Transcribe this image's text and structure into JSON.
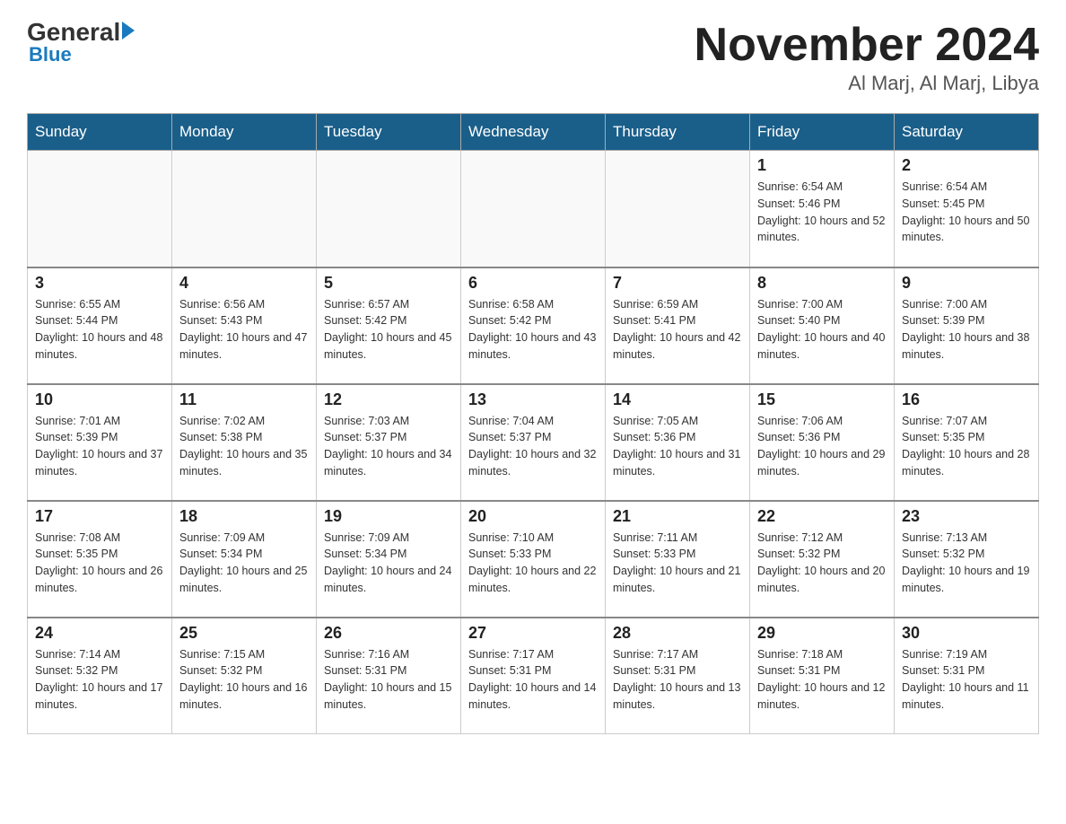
{
  "header": {
    "logo_general": "General",
    "logo_blue": "Blue",
    "month_title": "November 2024",
    "location": "Al Marj, Al Marj, Libya"
  },
  "days_of_week": [
    "Sunday",
    "Monday",
    "Tuesday",
    "Wednesday",
    "Thursday",
    "Friday",
    "Saturday"
  ],
  "weeks": [
    [
      {
        "day": "",
        "sunrise": "",
        "sunset": "",
        "daylight": ""
      },
      {
        "day": "",
        "sunrise": "",
        "sunset": "",
        "daylight": ""
      },
      {
        "day": "",
        "sunrise": "",
        "sunset": "",
        "daylight": ""
      },
      {
        "day": "",
        "sunrise": "",
        "sunset": "",
        "daylight": ""
      },
      {
        "day": "",
        "sunrise": "",
        "sunset": "",
        "daylight": ""
      },
      {
        "day": "1",
        "sunrise": "Sunrise: 6:54 AM",
        "sunset": "Sunset: 5:46 PM",
        "daylight": "Daylight: 10 hours and 52 minutes."
      },
      {
        "day": "2",
        "sunrise": "Sunrise: 6:54 AM",
        "sunset": "Sunset: 5:45 PM",
        "daylight": "Daylight: 10 hours and 50 minutes."
      }
    ],
    [
      {
        "day": "3",
        "sunrise": "Sunrise: 6:55 AM",
        "sunset": "Sunset: 5:44 PM",
        "daylight": "Daylight: 10 hours and 48 minutes."
      },
      {
        "day": "4",
        "sunrise": "Sunrise: 6:56 AM",
        "sunset": "Sunset: 5:43 PM",
        "daylight": "Daylight: 10 hours and 47 minutes."
      },
      {
        "day": "5",
        "sunrise": "Sunrise: 6:57 AM",
        "sunset": "Sunset: 5:42 PM",
        "daylight": "Daylight: 10 hours and 45 minutes."
      },
      {
        "day": "6",
        "sunrise": "Sunrise: 6:58 AM",
        "sunset": "Sunset: 5:42 PM",
        "daylight": "Daylight: 10 hours and 43 minutes."
      },
      {
        "day": "7",
        "sunrise": "Sunrise: 6:59 AM",
        "sunset": "Sunset: 5:41 PM",
        "daylight": "Daylight: 10 hours and 42 minutes."
      },
      {
        "day": "8",
        "sunrise": "Sunrise: 7:00 AM",
        "sunset": "Sunset: 5:40 PM",
        "daylight": "Daylight: 10 hours and 40 minutes."
      },
      {
        "day": "9",
        "sunrise": "Sunrise: 7:00 AM",
        "sunset": "Sunset: 5:39 PM",
        "daylight": "Daylight: 10 hours and 38 minutes."
      }
    ],
    [
      {
        "day": "10",
        "sunrise": "Sunrise: 7:01 AM",
        "sunset": "Sunset: 5:39 PM",
        "daylight": "Daylight: 10 hours and 37 minutes."
      },
      {
        "day": "11",
        "sunrise": "Sunrise: 7:02 AM",
        "sunset": "Sunset: 5:38 PM",
        "daylight": "Daylight: 10 hours and 35 minutes."
      },
      {
        "day": "12",
        "sunrise": "Sunrise: 7:03 AM",
        "sunset": "Sunset: 5:37 PM",
        "daylight": "Daylight: 10 hours and 34 minutes."
      },
      {
        "day": "13",
        "sunrise": "Sunrise: 7:04 AM",
        "sunset": "Sunset: 5:37 PM",
        "daylight": "Daylight: 10 hours and 32 minutes."
      },
      {
        "day": "14",
        "sunrise": "Sunrise: 7:05 AM",
        "sunset": "Sunset: 5:36 PM",
        "daylight": "Daylight: 10 hours and 31 minutes."
      },
      {
        "day": "15",
        "sunrise": "Sunrise: 7:06 AM",
        "sunset": "Sunset: 5:36 PM",
        "daylight": "Daylight: 10 hours and 29 minutes."
      },
      {
        "day": "16",
        "sunrise": "Sunrise: 7:07 AM",
        "sunset": "Sunset: 5:35 PM",
        "daylight": "Daylight: 10 hours and 28 minutes."
      }
    ],
    [
      {
        "day": "17",
        "sunrise": "Sunrise: 7:08 AM",
        "sunset": "Sunset: 5:35 PM",
        "daylight": "Daylight: 10 hours and 26 minutes."
      },
      {
        "day": "18",
        "sunrise": "Sunrise: 7:09 AM",
        "sunset": "Sunset: 5:34 PM",
        "daylight": "Daylight: 10 hours and 25 minutes."
      },
      {
        "day": "19",
        "sunrise": "Sunrise: 7:09 AM",
        "sunset": "Sunset: 5:34 PM",
        "daylight": "Daylight: 10 hours and 24 minutes."
      },
      {
        "day": "20",
        "sunrise": "Sunrise: 7:10 AM",
        "sunset": "Sunset: 5:33 PM",
        "daylight": "Daylight: 10 hours and 22 minutes."
      },
      {
        "day": "21",
        "sunrise": "Sunrise: 7:11 AM",
        "sunset": "Sunset: 5:33 PM",
        "daylight": "Daylight: 10 hours and 21 minutes."
      },
      {
        "day": "22",
        "sunrise": "Sunrise: 7:12 AM",
        "sunset": "Sunset: 5:32 PM",
        "daylight": "Daylight: 10 hours and 20 minutes."
      },
      {
        "day": "23",
        "sunrise": "Sunrise: 7:13 AM",
        "sunset": "Sunset: 5:32 PM",
        "daylight": "Daylight: 10 hours and 19 minutes."
      }
    ],
    [
      {
        "day": "24",
        "sunrise": "Sunrise: 7:14 AM",
        "sunset": "Sunset: 5:32 PM",
        "daylight": "Daylight: 10 hours and 17 minutes."
      },
      {
        "day": "25",
        "sunrise": "Sunrise: 7:15 AM",
        "sunset": "Sunset: 5:32 PM",
        "daylight": "Daylight: 10 hours and 16 minutes."
      },
      {
        "day": "26",
        "sunrise": "Sunrise: 7:16 AM",
        "sunset": "Sunset: 5:31 PM",
        "daylight": "Daylight: 10 hours and 15 minutes."
      },
      {
        "day": "27",
        "sunrise": "Sunrise: 7:17 AM",
        "sunset": "Sunset: 5:31 PM",
        "daylight": "Daylight: 10 hours and 14 minutes."
      },
      {
        "day": "28",
        "sunrise": "Sunrise: 7:17 AM",
        "sunset": "Sunset: 5:31 PM",
        "daylight": "Daylight: 10 hours and 13 minutes."
      },
      {
        "day": "29",
        "sunrise": "Sunrise: 7:18 AM",
        "sunset": "Sunset: 5:31 PM",
        "daylight": "Daylight: 10 hours and 12 minutes."
      },
      {
        "day": "30",
        "sunrise": "Sunrise: 7:19 AM",
        "sunset": "Sunset: 5:31 PM",
        "daylight": "Daylight: 10 hours and 11 minutes."
      }
    ]
  ]
}
